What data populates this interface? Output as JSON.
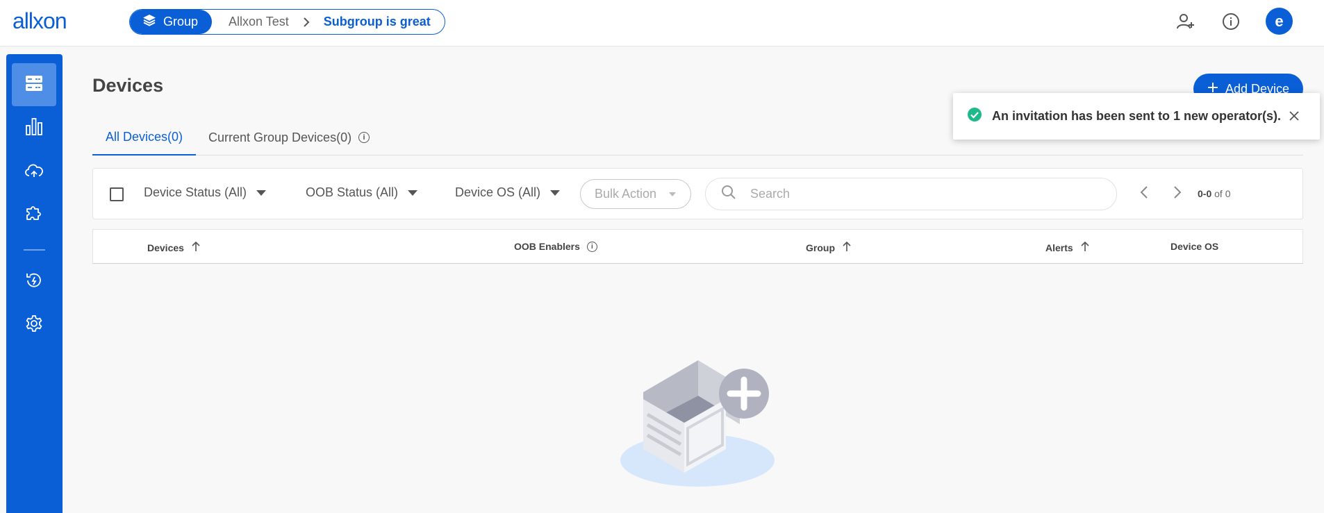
{
  "header": {
    "logo_text": "allxon",
    "breadcrumb": {
      "group_label": "Group",
      "parent": "Allxon Test",
      "current": "Subgroup is great"
    },
    "avatar_letter": "e"
  },
  "sidebar": {
    "items": [
      {
        "icon": "devices-icon",
        "active": true
      },
      {
        "icon": "bar-chart-icon",
        "active": false
      },
      {
        "icon": "cloud-sync-icon",
        "active": false
      },
      {
        "icon": "puzzle-icon",
        "active": false
      },
      {
        "icon": "recovery-icon",
        "active": false
      },
      {
        "icon": "gear-icon",
        "active": false
      }
    ]
  },
  "main": {
    "title": "Devices",
    "add_button": "Add Device",
    "tabs": [
      {
        "label": "All Devices(0)",
        "active": true
      },
      {
        "label": "Current Group Devices(0)",
        "active": false
      }
    ],
    "filters": {
      "device_status": "Device Status (All)",
      "oob_status": "OOB Status (All)",
      "device_os": "Device OS (All)",
      "bulk_action": "Bulk Action",
      "search_placeholder": "Search",
      "pager_range": "0-0",
      "pager_total": "of 0"
    },
    "columns": [
      "Devices",
      "OOB Enablers",
      "Group",
      "Alerts",
      "Device OS"
    ]
  },
  "toast": {
    "message": "An invitation has been sent to 1 new operator(s)."
  },
  "colors": {
    "brand": "#0a5fd6",
    "success": "#1fb98c"
  }
}
